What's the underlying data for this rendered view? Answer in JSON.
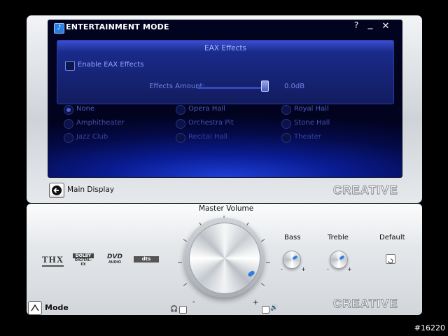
{
  "window": {
    "title": "ENTERTAINMENT MODE",
    "help": "?",
    "minimize": "_",
    "close": "✕"
  },
  "eax": {
    "panel_title": "EAX Effects",
    "enable_label": "Enable EAX Effects",
    "enabled": false,
    "amount_label": "Effects Amount:",
    "amount_value": "0.0dB"
  },
  "presets": [
    {
      "label": "None",
      "selected": true
    },
    {
      "label": "Opera Hall",
      "selected": false
    },
    {
      "label": "Royal Hall",
      "selected": false
    },
    {
      "label": "Amphitheater",
      "selected": false
    },
    {
      "label": "Orchestra Pit",
      "selected": false
    },
    {
      "label": "Stone Hall",
      "selected": false
    },
    {
      "label": "Jazz Club",
      "selected": false
    },
    {
      "label": "Recital Hall",
      "selected": false
    },
    {
      "label": "Theater",
      "selected": false
    }
  ],
  "nav": {
    "main_display": "Main Display",
    "mode": "Mode"
  },
  "brand": "CREATIVE",
  "controls": {
    "master_volume": "Master Volume",
    "bass": "Bass",
    "treble": "Treble",
    "default": "Default",
    "minus": "-",
    "plus": "+"
  },
  "logos": {
    "thx": "THX",
    "dolby_top": "DOLBY",
    "dolby_bottom": "DIGITAL-EX",
    "dvd_top": "DVD",
    "dvd_bottom": "AUDIO",
    "dts": "dts"
  },
  "watermark": "#16220",
  "colors": {
    "accent": "#2f7fe0",
    "panel_text": "#8fa6ff"
  }
}
